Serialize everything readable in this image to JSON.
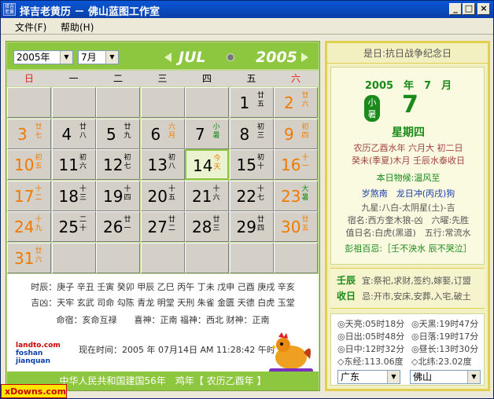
{
  "window": {
    "title": "择吉老黄历 － 佛山蓝图工作室",
    "icon_text": "择吉老黄历",
    "minimize": "_",
    "maximize": "□",
    "close": "×"
  },
  "menu": [
    {
      "label": "文件(F)"
    },
    {
      "label": "帮助(H)"
    }
  ],
  "calendar": {
    "year_select": "2005年",
    "month_select": "7月",
    "month_name": "JUL",
    "year_name": "2005",
    "weekdays": [
      "日",
      "一",
      "二",
      "三",
      "四",
      "五",
      "六"
    ],
    "weeks": [
      [
        {
          "d": "",
          "s": ""
        },
        {
          "d": "",
          "s": ""
        },
        {
          "d": "",
          "s": ""
        },
        {
          "d": "",
          "s": ""
        },
        {
          "d": "",
          "s": ""
        },
        {
          "d": "1",
          "s": "廿五"
        },
        {
          "d": "2",
          "s": "廿六"
        }
      ],
      [
        {
          "d": "3",
          "s": "廿七"
        },
        {
          "d": "4",
          "s": "廿八"
        },
        {
          "d": "5",
          "s": "廿九"
        },
        {
          "d": "6",
          "s": "六月"
        },
        {
          "d": "7",
          "s": "小暑"
        },
        {
          "d": "8",
          "s": "初三"
        },
        {
          "d": "9",
          "s": "初四"
        }
      ],
      [
        {
          "d": "10",
          "s": "初五"
        },
        {
          "d": "11",
          "s": "初六"
        },
        {
          "d": "12",
          "s": "初七"
        },
        {
          "d": "13",
          "s": "初八"
        },
        {
          "d": "14",
          "s": "今天"
        },
        {
          "d": "15",
          "s": "初十"
        },
        {
          "d": "16",
          "s": "十一"
        }
      ],
      [
        {
          "d": "17",
          "s": "十二"
        },
        {
          "d": "18",
          "s": "十三"
        },
        {
          "d": "19",
          "s": "十四"
        },
        {
          "d": "20",
          "s": "十五"
        },
        {
          "d": "21",
          "s": "十六"
        },
        {
          "d": "22",
          "s": "十七"
        },
        {
          "d": "23",
          "s": "大暑"
        }
      ],
      [
        {
          "d": "24",
          "s": "十九"
        },
        {
          "d": "25",
          "s": "二十"
        },
        {
          "d": "26",
          "s": "廿一"
        },
        {
          "d": "27",
          "s": "廿二"
        },
        {
          "d": "28",
          "s": "廿三"
        },
        {
          "d": "29",
          "s": "廿四"
        },
        {
          "d": "30",
          "s": "廿五"
        }
      ],
      [
        {
          "d": "31",
          "s": "廿六"
        },
        {
          "d": "",
          "s": ""
        },
        {
          "d": "",
          "s": ""
        },
        {
          "d": "",
          "s": ""
        },
        {
          "d": "",
          "s": ""
        },
        {
          "d": "",
          "s": ""
        },
        {
          "d": "",
          "s": ""
        }
      ]
    ],
    "today_index": [
      2,
      4
    ]
  },
  "hours": {
    "line1": "时辰：庚子 辛丑 壬寅 癸卯 甲辰 乙巳 丙午 丁未 戊申 己酉 庚戌 辛亥",
    "line2": "吉凶：天牢 玄武 司命 勾陈 青龙 明堂 天刑 朱雀 金匮 天德 白虎 玉堂",
    "line3": "命宿：亥命互禄　　喜神：正南 福神：西北 财神：正南"
  },
  "logo": {
    "line1": "landto.com",
    "line2": "foshan jianquan"
  },
  "now_time": "现在时间：2005 年 07月14日 AM 11:28:42 午时",
  "footer": "中华人民共和国建国56年　鸡年【 农历乙酉年 】",
  "day": {
    "festival": "是日:抗日战争纪念日",
    "year_month": "2005　年　7　月",
    "solar_term": "小暑",
    "day_number": "7",
    "weekday": "星期四",
    "lunar1": "农历乙酉水年 六月大 初二日",
    "lunar2": "癸未(季夏)木月 壬辰水泰收日",
    "object": "本日物候:温风至",
    "clash": "岁煞南　龙日冲(丙戌)狗",
    "star1": "九星:八白-太阴星(土)-吉",
    "star2": "宿名:西方奎木狼-凶　六曜:先胜",
    "star3": "值日名:白虎(黑道)　五行:常流水",
    "taboo": "彭祖百忌:［壬不泱水 辰不哭泣］"
  },
  "yiji": {
    "yi_key": "壬辰",
    "yi_val": "宜:祭祀,求财,签约,嫁娶,订盟",
    "ji_key": "收日",
    "ji_val": "忌:开市,安床,安葬,入宅,破土"
  },
  "sun": {
    "row1a": "◎天亮:05时18分",
    "row1b": "◎天黑:19时47分",
    "row2a": "◎日出:05时48分",
    "row2b": "◎日落:19时17分",
    "row3a": "◎日中:12时32分",
    "row3b": "◎昼长:13时30分",
    "row4a": "◇东经:113.06度",
    "row4b": "◇北纬:23.02度",
    "province": "广东",
    "city": "佛山"
  },
  "watermark": "xDowns.com",
  "colors": {
    "accent": "#8dc63f",
    "weekend": "#f07a00",
    "term": "#1a8a1a"
  }
}
